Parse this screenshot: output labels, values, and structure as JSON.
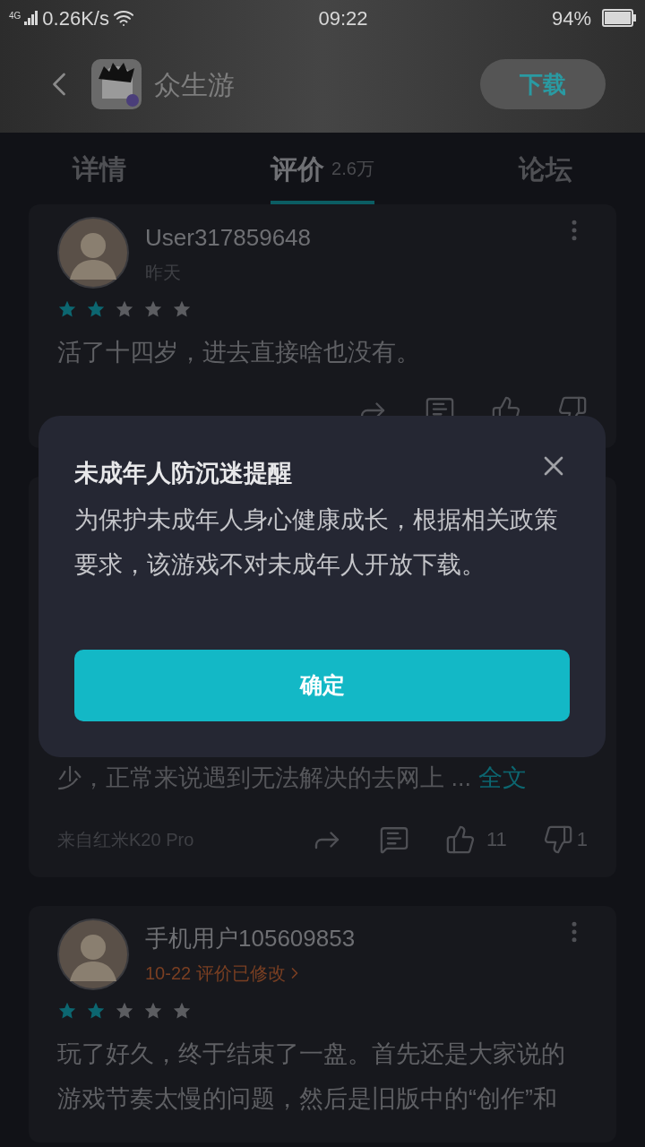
{
  "status_bar": {
    "network": "4G",
    "speed": "0.26K/s",
    "time": "09:22",
    "battery": "94%"
  },
  "header": {
    "title": "众生游",
    "download": "下载"
  },
  "tabs": [
    {
      "label": "详情",
      "selected": false
    },
    {
      "label": "评价",
      "count": "2.6万",
      "selected": true
    },
    {
      "label": "论坛",
      "selected": false
    }
  ],
  "reviews": [
    {
      "kind": "full",
      "user": "User317859648",
      "date": "昨天",
      "edited": false,
      "stars": 2,
      "text": "活了十四岁，进去直接啥也没有。"
    },
    {
      "kind": "tail",
      "text": "少，正常来说遇到无法解决的去网上 ...",
      "more": "全文",
      "device": "来自红米K20 Pro",
      "likes": "11",
      "dislikes": "1"
    },
    {
      "kind": "full",
      "user": "手机用户105609853",
      "date": "10-22 评价已修改",
      "edited": true,
      "stars": 2,
      "text": "玩了好久，终于结束了一盘。首先还是大家说的游戏节奏太慢的问题，然后是旧版中的“创作”和"
    }
  ],
  "dialog": {
    "title": "未成年人防沉迷提醒",
    "body": "为保护未成年人身心健康成长，根据相关政策要求，该游戏不对未成年人开放下载。",
    "confirm": "确定"
  }
}
